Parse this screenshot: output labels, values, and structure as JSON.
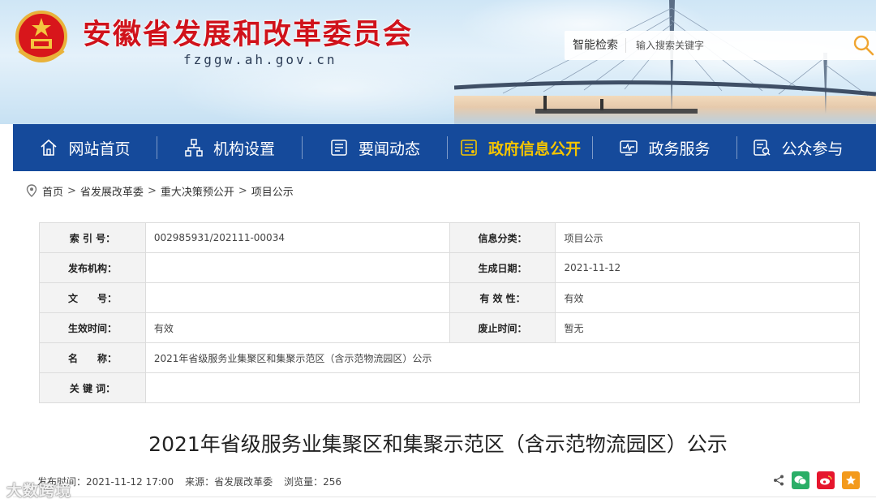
{
  "header": {
    "title": "安徽省发展和改革委员会",
    "domain": "fzggw.ah.gov.cn",
    "search": {
      "label": "智能检索",
      "placeholder": "输入搜索关键字"
    }
  },
  "nav": [
    {
      "label": "网站首页",
      "icon": "home-icon"
    },
    {
      "label": "机构设置",
      "icon": "org-chart-icon"
    },
    {
      "label": "要闻动态",
      "icon": "news-icon"
    },
    {
      "label": "政府信息公开",
      "icon": "info-open-icon",
      "active": true
    },
    {
      "label": "政务服务",
      "icon": "monitor-icon"
    },
    {
      "label": "公众参与",
      "icon": "participation-icon"
    }
  ],
  "breadcrumb": [
    "首页",
    "省发展改革委",
    "重大决策预公开",
    "项目公示"
  ],
  "meta": {
    "index_label": "索 引 号：",
    "index_value": "002985931/202111-00034",
    "category_label": "信息分类：",
    "category_value": "项目公示",
    "publisher_label": "发布机构：",
    "publisher_value": "",
    "created_label": "生成日期：",
    "created_value": "2021-11-12",
    "docno_label": "文　　号：",
    "docno_value": "",
    "validity_label": "有 效 性：",
    "validity_value": "有效",
    "effective_label": "生效时间：",
    "effective_value": "有效",
    "expire_label": "废止时间：",
    "expire_value": "暂无",
    "name_label": "名　　称：",
    "name_value": "2021年省级服务业集聚区和集聚示范区（含示范物流园区）公示",
    "keywords_label": "关 键 词：",
    "keywords_value": ""
  },
  "article": {
    "title": "2021年省级服务业集聚区和集聚示范区（含示范物流园区）公示",
    "publish_time": "发布时间：2021-11-12 17:00",
    "source": "来源：省发展改革委",
    "views": "浏览量：256"
  },
  "watermark": "大数跨境",
  "colors": {
    "nav_bg": "#154a9b",
    "title_red": "#d0121b",
    "active_yellow": "#f5c500"
  }
}
